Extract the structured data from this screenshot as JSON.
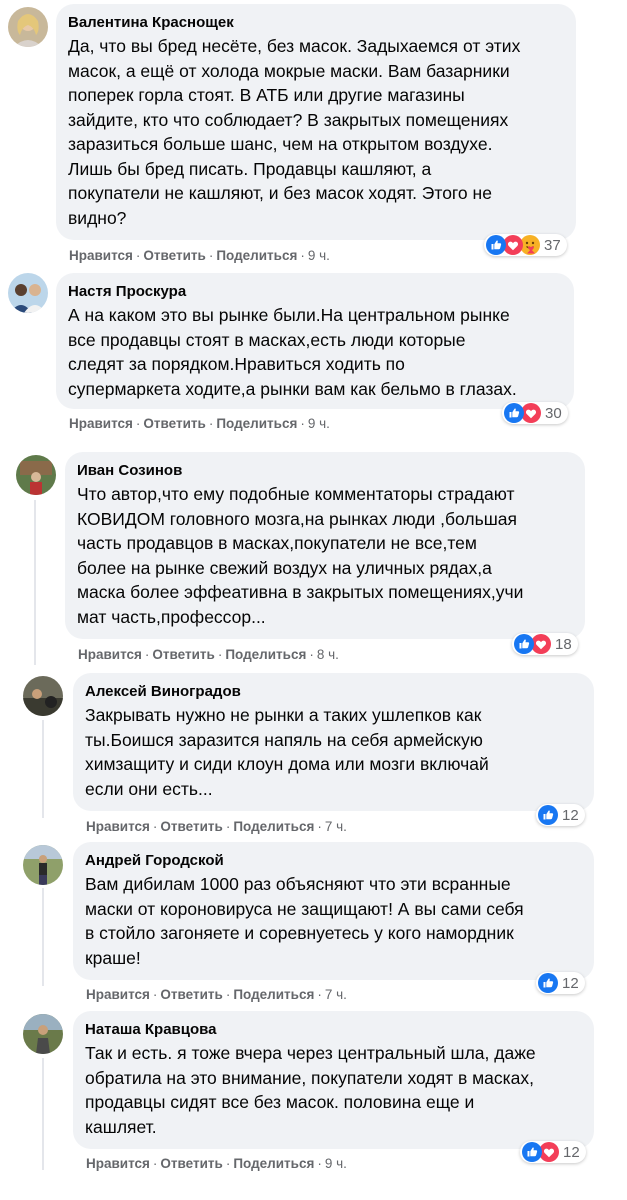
{
  "actions": {
    "like": "Нравится",
    "reply": "Ответить",
    "share": "Поделиться",
    "sep": "·"
  },
  "colors": {
    "bubble": "#f0f2f5",
    "like_blue": "#1877f2",
    "love_red": "#f33e58",
    "care_yellow": "#f7b125",
    "meta_gray": "#65676b"
  },
  "comments": [
    {
      "author": "Валентина Краснощек",
      "lines": [
        "Да, что вы бред несёте, без масок. Задыхаемся от этих",
        "масок, а ещё от холода мокрые маски. Вам базарники",
        "поперек горла стоят. В АТБ или другие магазины",
        "зайдите, кто что соблюдает? В закрытых помещениях",
        "заразиться больше шанс, чем на открытом воздухе.",
        "Лишь бы бред писать. Продавцы кашляют, а",
        "покупатели не кашляют, и без масок ходят. Этого не",
        "видно?"
      ],
      "time": "9 ч.",
      "reactions": [
        "like-icon",
        "love-icon",
        "care-icon"
      ],
      "reaction_count": "37"
    },
    {
      "author": "Настя Проскура",
      "lines": [
        "А на каком это вы рынке были.На центральном рынке",
        "все продавцы стоят в масках,есть люди которые",
        "следят за порядком.Нравиться ходить по",
        "супермаркета ходите,а рынки вам как бельмо в глазах."
      ],
      "time": "9 ч.",
      "reactions": [
        "like-icon",
        "love-icon"
      ],
      "reaction_count": "30"
    },
    {
      "author": "Иван Созинов",
      "lines": [
        "Что автор,что ему подобные комментаторы страдают",
        "КОВИДОМ головного мозга,на рынках люди ,большая",
        "часть продавцов в масках,покупатели не все,тем",
        "более на рынке свежий воздух на уличных рядах,а",
        "маска более эффеативна в закрытых помещениях,учи",
        "мат часть,профессор..."
      ],
      "time": "8 ч.",
      "reactions": [
        "like-icon",
        "love-icon"
      ],
      "reaction_count": "18"
    },
    {
      "author": "Алексей Виноградов",
      "lines": [
        "Закрывать нужно не рынки а таких ушлепков как",
        "ты.Боишся заразится напяль на себя армейскую",
        "химзащиту и сиди клоун дома или мозги включай",
        "если они есть..."
      ],
      "time": "7 ч.",
      "reactions": [
        "like-icon"
      ],
      "reaction_count": "12"
    },
    {
      "author": "Андрей Городской",
      "lines": [
        "Вам дибилам 1000 раз объясняют что эти всранные",
        "маски от короновируса не защищают! А вы сами себя",
        "в стойло загоняете и соревнуетесь у кого намордник",
        "краше!"
      ],
      "time": "7 ч.",
      "reactions": [
        "like-icon"
      ],
      "reaction_count": "12"
    },
    {
      "author": "Наташа Кравцова",
      "lines": [
        "Так и есть. я тоже вчера через центральный шла, даже",
        "обратила на это внимание, покупатели ходят в масках,",
        "продавцы сидят все без масок. половина еще и",
        "кашляет."
      ],
      "time": "9 ч.",
      "reactions": [
        "like-icon",
        "love-icon"
      ],
      "reaction_count": "12"
    }
  ]
}
